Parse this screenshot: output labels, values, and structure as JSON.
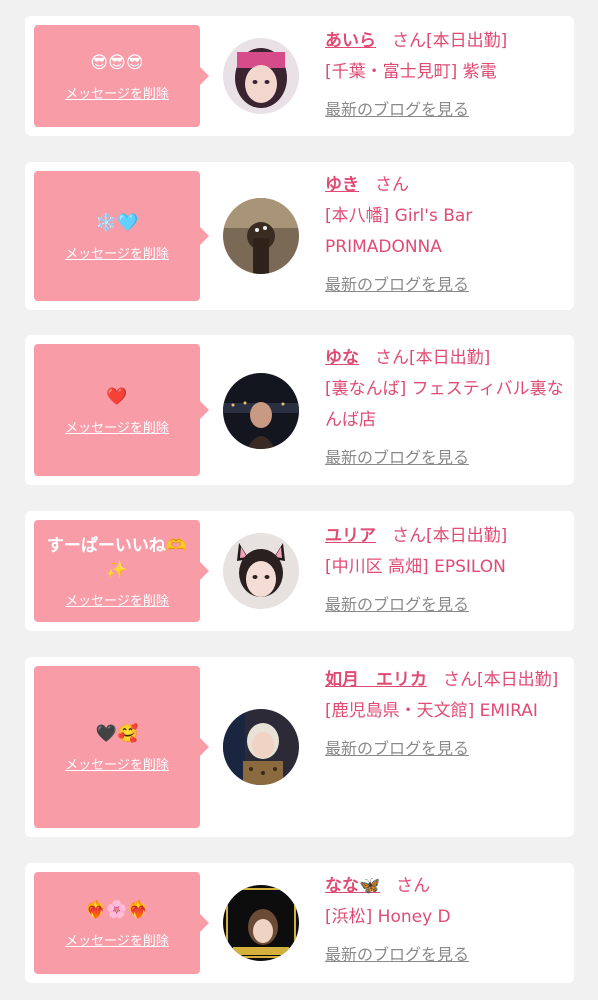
{
  "delete_label": "メッセージを削除",
  "blog_label": "最新のブログを見る",
  "san_label": "さん",
  "accent_color": "#e04b74",
  "bubble_color": "#f89ca8",
  "messages": [
    {
      "emoji": "😎😎😎",
      "name": "あいら",
      "suffix": "[本日出勤]",
      "shop": "[千葉・富士見町] 紫電"
    },
    {
      "emoji": "❄️🩵",
      "name": "ゆき",
      "suffix": "",
      "shop": "[本八幡] Girl's Bar PRIMADONNA"
    },
    {
      "emoji": "❤️",
      "name": "ゆな",
      "suffix": "[本日出勤]",
      "shop": "[裏なんば] フェスティバル裏なんば店"
    },
    {
      "emoji": "すーぱーいいね🫶✨",
      "name": "ユリア",
      "suffix": "[本日出勤]",
      "shop": "[中川区 高畑] EPSILON"
    },
    {
      "emoji": "🖤🥰",
      "name": "如月　エリカ",
      "suffix": "[本日出勤]",
      "shop": "[鹿児島県・天文館] EMIRAI"
    },
    {
      "emoji": "❤️‍🔥🌸❤️‍🔥",
      "name": "なな🦋",
      "suffix": "",
      "shop": "[浜松] Honey D"
    }
  ]
}
